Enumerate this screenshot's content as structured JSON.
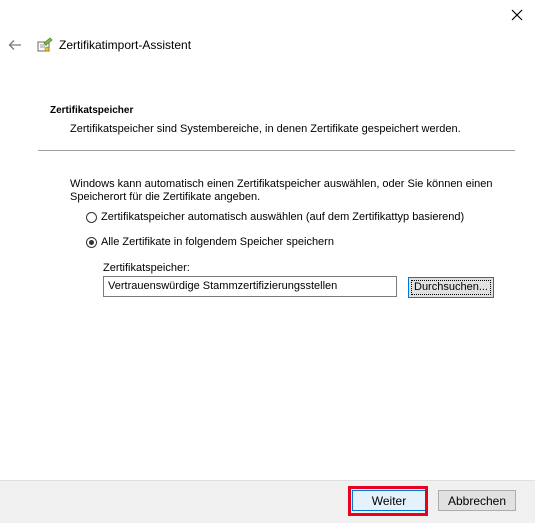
{
  "window": {
    "title": "Zertifikatimport-Assistent"
  },
  "section": {
    "heading": "Zertifikatspeicher",
    "description": "Zertifikatspeicher sind Systembereiche, in denen Zertifikate gespeichert werden."
  },
  "intro": "Windows kann automatisch einen Zertifikatspeicher auswählen, oder Sie können einen Speicherort für die Zertifikate angeben.",
  "options": [
    {
      "label": "Zertifikatspeicher automatisch auswählen (auf dem Zertifikattyp basierend)",
      "selected": false
    },
    {
      "label": "Alle Zertifikate in folgendem Speicher speichern",
      "selected": true
    }
  ],
  "store": {
    "label": "Zertifikatspeicher:",
    "value": "Vertrauenswürdige Stammzertifizierungsstellen",
    "browse_label": "Durchsuchen..."
  },
  "footer": {
    "next_label": "Weiter",
    "cancel_label": "Abbrechen"
  },
  "colors": {
    "highlight": "#e8001c",
    "focus": "#0078d7"
  },
  "icons": {
    "close": "close-icon",
    "back": "back-arrow-icon",
    "wizard": "certificate-wizard-icon"
  }
}
